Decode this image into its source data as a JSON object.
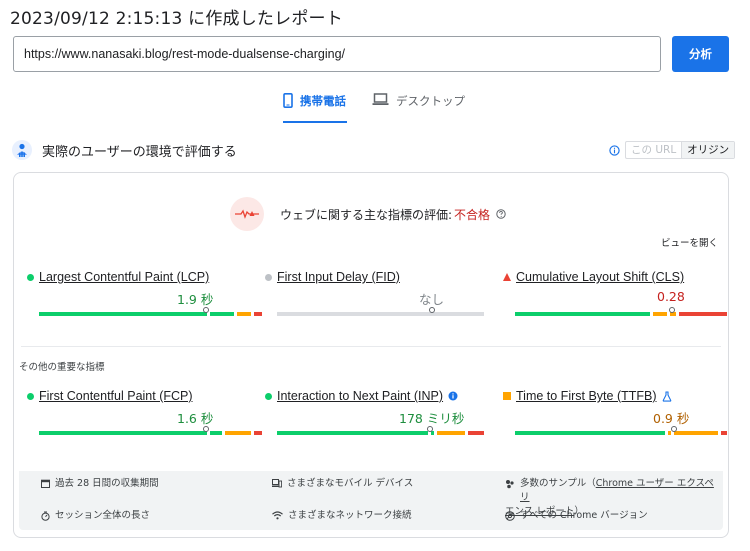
{
  "report": {
    "timestamp": "2023/09/12 2:15:13 に作成したレポート"
  },
  "search": {
    "url": "https://www.nanasaki.blog/rest-mode-dualsense-charging/",
    "analyze_label": "分析"
  },
  "tabs": {
    "mobile": "携帯電話",
    "desktop": "デスクトップ"
  },
  "field": {
    "title": "実際のユーザーの環境で評価する",
    "scope_url": "この URL",
    "scope_origin": "オリジン"
  },
  "assessment": {
    "label": "ウェブに関する主な指標の評価: ",
    "result": "不合格"
  },
  "expand_label": "ビューを開く",
  "other_label": "その他の重要な指標",
  "metrics": {
    "lcp": {
      "name": "Largest Contentful Paint (LCP)",
      "value": "1.9 秒",
      "status": "good",
      "marker_fraction": 0.75
    },
    "fid": {
      "name": "First Input Delay (FID)",
      "value": "なし",
      "status": "none",
      "marker_fraction": 0.75
    },
    "cls": {
      "name": "Cumulative Layout Shift (CLS)",
      "value": "0.28",
      "status": "poor",
      "marker_fraction": 0.74
    },
    "fcp": {
      "name": "First Contentful Paint (FCP)",
      "value": "1.6 秒",
      "status": "good",
      "marker_fraction": 0.75
    },
    "inp": {
      "name": "Interaction to Next Paint (INP)",
      "value": "178 ミリ秒",
      "status": "good",
      "marker_fraction": 0.74
    },
    "ttfb": {
      "name": "Time to First Byte (TTFB)",
      "value": "0.9 秒",
      "status": "needs-improvement",
      "marker_fraction": 0.75
    }
  },
  "footer": {
    "period": "過去 28 日間の収集期間",
    "devices": "さまざまなモバイル デバイス",
    "samples_prefix": "多数のサンプル（",
    "samples_link_1": "Chrome ユーザー エクスペリ",
    "samples_link_2": "エンス レポート",
    "samples_suffix": "）",
    "session": "セッション全体の長さ",
    "network": "さまざまなネットワーク接続",
    "chrome": "すべての Chrome バージョン"
  },
  "colors": {
    "good": "#1e8e3e",
    "good_bar": "#0cce6b",
    "average": "#ffa400",
    "poor": "#c5221f",
    "poor_bar": "#ea4335",
    "accent": "#1a73e8",
    "none": "#bdc1c6"
  }
}
